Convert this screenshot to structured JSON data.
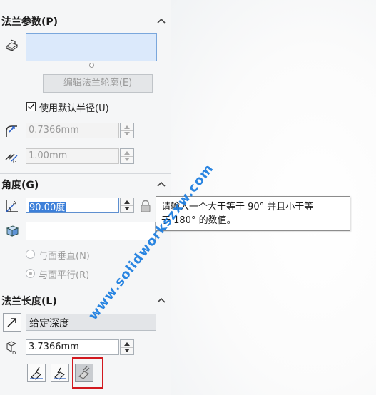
{
  "flange_params": {
    "title": "法兰参数(P)",
    "edit_profile_label": "编辑法兰轮廓(E)",
    "default_radius_label": "使用默认半径(U)",
    "default_radius_checked": true,
    "radius_value": "0.7366mm",
    "gap_value": "1.00mm"
  },
  "angle": {
    "title": "角度(G)",
    "angle_value": "90.00度",
    "reference_value": "",
    "perpendicular_label": "与面垂直(N)",
    "parallel_label": "与面平行(R)",
    "selected_option": "parallel"
  },
  "flange_length": {
    "title": "法兰长度(L)",
    "end_condition": "给定深度",
    "length_value": "3.7366mm"
  },
  "tooltip": {
    "line1": "请输入一个大于等于 90° 并且小于等",
    "line2": "于 180° 的数值。"
  },
  "watermark": {
    "text": "www.solidworkszxw.com"
  },
  "colors": {
    "accent": "#3c7fd9",
    "highlight": "#d2191f",
    "watermark": "#1f7fe0",
    "selection_box": "#dbe9fb"
  }
}
